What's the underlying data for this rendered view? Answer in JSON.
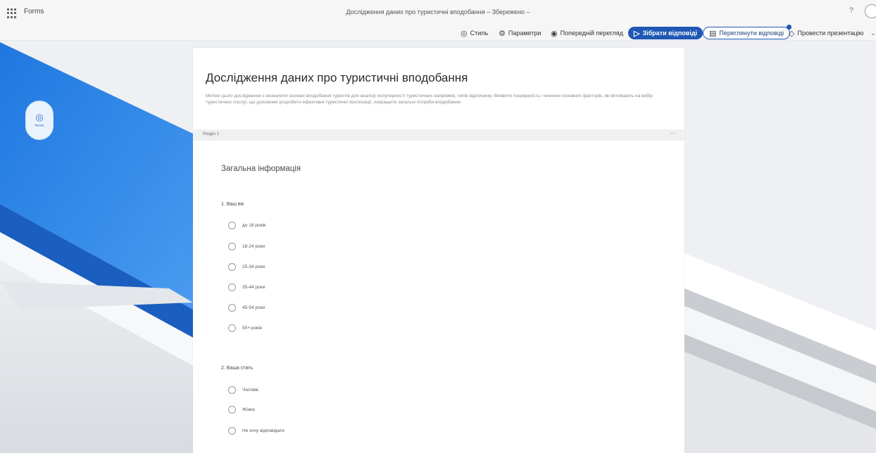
{
  "app": {
    "name": "Forms",
    "title": "Дослідження даних про туристичні вподобання – Збережено –"
  },
  "toolbar": {
    "style_label": "Стиль",
    "params_label": "Параметри",
    "preview_label": "Попередній перегляд",
    "collect_label": "Зібрати відповіді",
    "responses_label": "Переглянути відповіді",
    "presentation_label": "Провести презентацію"
  },
  "brand": {
    "caption": "forms"
  },
  "form": {
    "title": "Дослідження даних про туристичні вподобання",
    "description": "Метою цього дослідження є визначити основні вподобання туристів для аналізу популярності туристичних напрямків, типів відпочинку. Виявити поширеність і чинники основних факторів, які впливають на вибір туристичних послуг, що допоможе розробити ефективні туристичні пропозиції, покращити загальні потреби вподобання."
  },
  "section": {
    "label": "Розділ 1",
    "heading": "Загальна інформація"
  },
  "questions": [
    {
      "label": "1. Ваш вік",
      "options": [
        "до 18 років",
        "18-24 роки",
        "25-34 роки",
        "35-44 роки",
        "45-54 роки",
        "55+ років"
      ]
    },
    {
      "label": "2. Ваша стать",
      "options": [
        "Чоловік",
        "Жінка",
        "Не хочу відповідати"
      ]
    }
  ],
  "colors": {
    "accent": "#1f58b4",
    "bg_blue": "#2f86e8",
    "card": "#ffffff"
  },
  "icons": {
    "app_grid": "grid-icon",
    "style": "palette-icon",
    "params": "gear-icon",
    "preview": "eye-icon",
    "collect": "send-icon",
    "responses": "chart-icon",
    "presentation": "shield-icon"
  }
}
